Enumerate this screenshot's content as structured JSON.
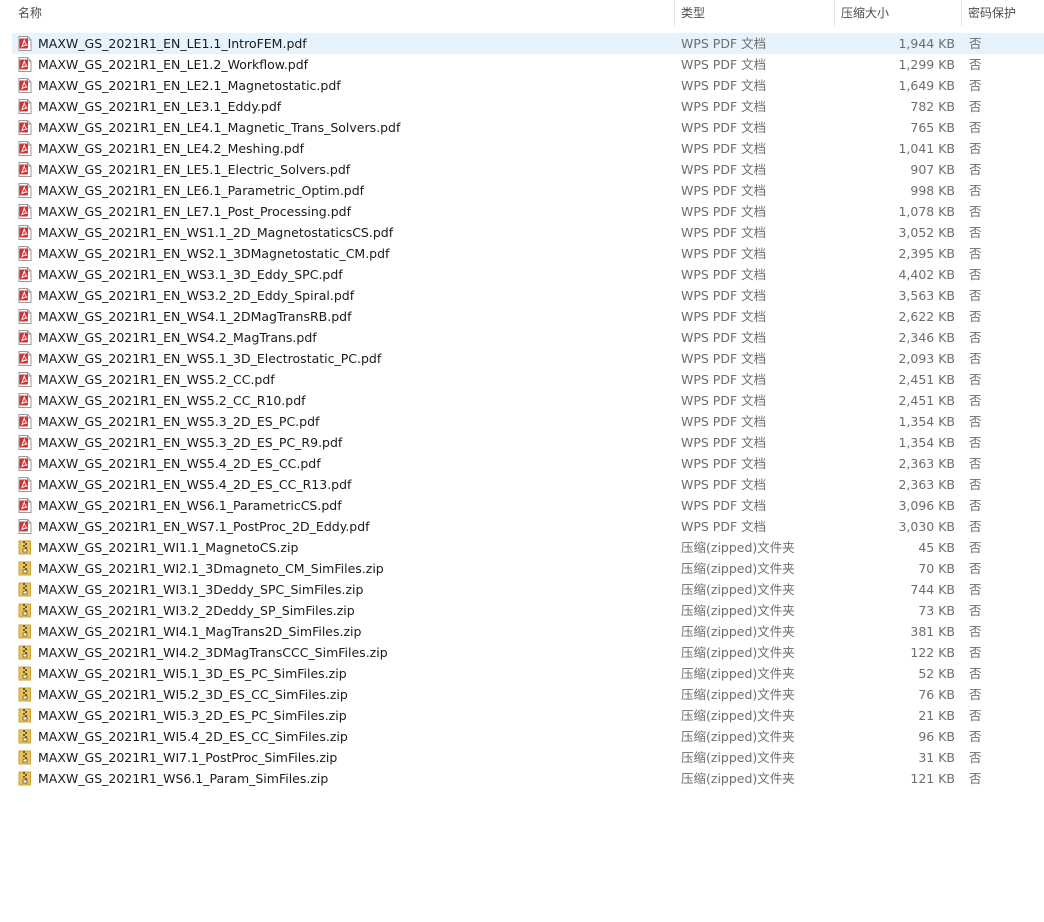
{
  "header": {
    "name": "名称",
    "type": "类型",
    "compressed_size": "压缩大小",
    "password_protected": "密码保护",
    "sort_indicator": "^"
  },
  "colors": {
    "selected_row": "#e5f3ff",
    "pdf_icon": "#d13438",
    "zip_icon": "#e8c25a"
  },
  "files": [
    {
      "name": "MAXW_GS_2021R1_EN_LE1.1_IntroFEM.pdf",
      "type": "WPS PDF 文档",
      "size": "1,944 KB",
      "protected": "否",
      "icon": "pdf-icon",
      "selected": true
    },
    {
      "name": "MAXW_GS_2021R1_EN_LE1.2_Workflow.pdf",
      "type": "WPS PDF 文档",
      "size": "1,299 KB",
      "protected": "否",
      "icon": "pdf-icon"
    },
    {
      "name": "MAXW_GS_2021R1_EN_LE2.1_Magnetostatic.pdf",
      "type": "WPS PDF 文档",
      "size": "1,649 KB",
      "protected": "否",
      "icon": "pdf-icon"
    },
    {
      "name": "MAXW_GS_2021R1_EN_LE3.1_Eddy.pdf",
      "type": "WPS PDF 文档",
      "size": "782 KB",
      "protected": "否",
      "icon": "pdf-icon"
    },
    {
      "name": "MAXW_GS_2021R1_EN_LE4.1_Magnetic_Trans_Solvers.pdf",
      "type": "WPS PDF 文档",
      "size": "765 KB",
      "protected": "否",
      "icon": "pdf-icon"
    },
    {
      "name": "MAXW_GS_2021R1_EN_LE4.2_Meshing.pdf",
      "type": "WPS PDF 文档",
      "size": "1,041 KB",
      "protected": "否",
      "icon": "pdf-icon"
    },
    {
      "name": "MAXW_GS_2021R1_EN_LE5.1_Electric_Solvers.pdf",
      "type": "WPS PDF 文档",
      "size": "907 KB",
      "protected": "否",
      "icon": "pdf-icon"
    },
    {
      "name": "MAXW_GS_2021R1_EN_LE6.1_Parametric_Optim.pdf",
      "type": "WPS PDF 文档",
      "size": "998 KB",
      "protected": "否",
      "icon": "pdf-icon"
    },
    {
      "name": "MAXW_GS_2021R1_EN_LE7.1_Post_Processing.pdf",
      "type": "WPS PDF 文档",
      "size": "1,078 KB",
      "protected": "否",
      "icon": "pdf-icon"
    },
    {
      "name": "MAXW_GS_2021R1_EN_WS1.1_2D_MagnetostaticsCS.pdf",
      "type": "WPS PDF 文档",
      "size": "3,052 KB",
      "protected": "否",
      "icon": "pdf-icon"
    },
    {
      "name": "MAXW_GS_2021R1_EN_WS2.1_3DMagnetostatic_CM.pdf",
      "type": "WPS PDF 文档",
      "size": "2,395 KB",
      "protected": "否",
      "icon": "pdf-icon"
    },
    {
      "name": "MAXW_GS_2021R1_EN_WS3.1_3D_Eddy_SPC.pdf",
      "type": "WPS PDF 文档",
      "size": "4,402 KB",
      "protected": "否",
      "icon": "pdf-icon"
    },
    {
      "name": "MAXW_GS_2021R1_EN_WS3.2_2D_Eddy_Spiral.pdf",
      "type": "WPS PDF 文档",
      "size": "3,563 KB",
      "protected": "否",
      "icon": "pdf-icon"
    },
    {
      "name": "MAXW_GS_2021R1_EN_WS4.1_2DMagTransRB.pdf",
      "type": "WPS PDF 文档",
      "size": "2,622 KB",
      "protected": "否",
      "icon": "pdf-icon"
    },
    {
      "name": "MAXW_GS_2021R1_EN_WS4.2_MagTrans.pdf",
      "type": "WPS PDF 文档",
      "size": "2,346 KB",
      "protected": "否",
      "icon": "pdf-icon"
    },
    {
      "name": "MAXW_GS_2021R1_EN_WS5.1_3D_Electrostatic_PC.pdf",
      "type": "WPS PDF 文档",
      "size": "2,093 KB",
      "protected": "否",
      "icon": "pdf-icon"
    },
    {
      "name": "MAXW_GS_2021R1_EN_WS5.2_CC.pdf",
      "type": "WPS PDF 文档",
      "size": "2,451 KB",
      "protected": "否",
      "icon": "pdf-icon"
    },
    {
      "name": "MAXW_GS_2021R1_EN_WS5.2_CC_R10.pdf",
      "type": "WPS PDF 文档",
      "size": "2,451 KB",
      "protected": "否",
      "icon": "pdf-icon"
    },
    {
      "name": "MAXW_GS_2021R1_EN_WS5.3_2D_ES_PC.pdf",
      "type": "WPS PDF 文档",
      "size": "1,354 KB",
      "protected": "否",
      "icon": "pdf-icon"
    },
    {
      "name": "MAXW_GS_2021R1_EN_WS5.3_2D_ES_PC_R9.pdf",
      "type": "WPS PDF 文档",
      "size": "1,354 KB",
      "protected": "否",
      "icon": "pdf-icon"
    },
    {
      "name": "MAXW_GS_2021R1_EN_WS5.4_2D_ES_CC.pdf",
      "type": "WPS PDF 文档",
      "size": "2,363 KB",
      "protected": "否",
      "icon": "pdf-icon"
    },
    {
      "name": "MAXW_GS_2021R1_EN_WS5.4_2D_ES_CC_R13.pdf",
      "type": "WPS PDF 文档",
      "size": "2,363 KB",
      "protected": "否",
      "icon": "pdf-icon"
    },
    {
      "name": "MAXW_GS_2021R1_EN_WS6.1_ParametricCS.pdf",
      "type": "WPS PDF 文档",
      "size": "3,096 KB",
      "protected": "否",
      "icon": "pdf-icon"
    },
    {
      "name": "MAXW_GS_2021R1_EN_WS7.1_PostProc_2D_Eddy.pdf",
      "type": "WPS PDF 文档",
      "size": "3,030 KB",
      "protected": "否",
      "icon": "pdf-icon"
    },
    {
      "name": "MAXW_GS_2021R1_WI1.1_MagnetoCS.zip",
      "type": "压缩(zipped)文件夹",
      "size": "45 KB",
      "protected": "否",
      "icon": "zip-folder-icon"
    },
    {
      "name": "MAXW_GS_2021R1_WI2.1_3Dmagneto_CM_SimFiles.zip",
      "type": "压缩(zipped)文件夹",
      "size": "70 KB",
      "protected": "否",
      "icon": "zip-folder-icon"
    },
    {
      "name": "MAXW_GS_2021R1_WI3.1_3Deddy_SPC_SimFiles.zip",
      "type": "压缩(zipped)文件夹",
      "size": "744 KB",
      "protected": "否",
      "icon": "zip-folder-icon"
    },
    {
      "name": "MAXW_GS_2021R1_WI3.2_2Deddy_SP_SimFiles.zip",
      "type": "压缩(zipped)文件夹",
      "size": "73 KB",
      "protected": "否",
      "icon": "zip-folder-icon"
    },
    {
      "name": "MAXW_GS_2021R1_WI4.1_MagTrans2D_SimFiles.zip",
      "type": "压缩(zipped)文件夹",
      "size": "381 KB",
      "protected": "否",
      "icon": "zip-folder-icon"
    },
    {
      "name": "MAXW_GS_2021R1_WI4.2_3DMagTransCCC_SimFiles.zip",
      "type": "压缩(zipped)文件夹",
      "size": "122 KB",
      "protected": "否",
      "icon": "zip-folder-icon"
    },
    {
      "name": "MAXW_GS_2021R1_WI5.1_3D_ES_PC_SimFiles.zip",
      "type": "压缩(zipped)文件夹",
      "size": "52 KB",
      "protected": "否",
      "icon": "zip-folder-icon"
    },
    {
      "name": "MAXW_GS_2021R1_WI5.2_3D_ES_CC_SimFiles.zip",
      "type": "压缩(zipped)文件夹",
      "size": "76 KB",
      "protected": "否",
      "icon": "zip-folder-icon"
    },
    {
      "name": "MAXW_GS_2021R1_WI5.3_2D_ES_PC_SimFiles.zip",
      "type": "压缩(zipped)文件夹",
      "size": "21 KB",
      "protected": "否",
      "icon": "zip-folder-icon"
    },
    {
      "name": "MAXW_GS_2021R1_WI5.4_2D_ES_CC_SimFiles.zip",
      "type": "压缩(zipped)文件夹",
      "size": "96 KB",
      "protected": "否",
      "icon": "zip-folder-icon"
    },
    {
      "name": "MAXW_GS_2021R1_WI7.1_PostProc_SimFiles.zip",
      "type": "压缩(zipped)文件夹",
      "size": "31 KB",
      "protected": "否",
      "icon": "zip-folder-icon"
    },
    {
      "name": "MAXW_GS_2021R1_WS6.1_Param_SimFiles.zip",
      "type": "压缩(zipped)文件夹",
      "size": "121 KB",
      "protected": "否",
      "icon": "zip-folder-icon"
    }
  ]
}
